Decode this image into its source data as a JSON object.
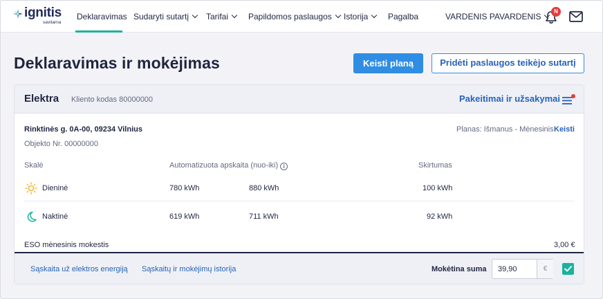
{
  "brand": {
    "name": "ignitis",
    "sub": "savitarna",
    "accent": "#1ab39c",
    "blue": "#2f8de4",
    "link": "#2862b8"
  },
  "nav": {
    "items": [
      {
        "label": "Deklaravimas",
        "has_chevron": false
      },
      {
        "label": "Sudaryti sutartį",
        "has_chevron": true
      },
      {
        "label": "Tarifai",
        "has_chevron": true
      },
      {
        "label": "Papildomos paslaugos",
        "has_chevron": true
      },
      {
        "label": "Istorija",
        "has_chevron": true
      },
      {
        "label": "Pagalba",
        "has_chevron": false
      }
    ],
    "active": "Deklaravimas",
    "user": "VARDENIS PAVARDENIS",
    "notification_badge": "N",
    "icons": [
      "bell-icon",
      "mail-icon",
      "chevron-down-icon"
    ]
  },
  "page": {
    "title": "Deklaravimas ir mokėjimas",
    "primary_button": "Keisti planą",
    "secondary_button": "Pridėti paslaugos teikėjo sutartį"
  },
  "card": {
    "title": "Elektra",
    "client_code": "Kliento kodas 80000000",
    "changes_link": "Pakeitimai ir užsakymai",
    "address": "Rinktinės g. 0A-00, 09234 Vilnius",
    "object_nr": "Objekto Nr. 00000000",
    "plan": "Planas: Išmanus - Mėnesinis",
    "plan_change": "Keisti",
    "headers": {
      "scale": "Skalė",
      "auto": "Automatizuota apskaita (nuo-iki)",
      "diff": "Skirtumas"
    },
    "rows": [
      {
        "name": "Dieninė",
        "icon": "sun-icon",
        "from": "780 kWh",
        "to": "880 kWh",
        "diff": "100 kWh"
      },
      {
        "name": "Naktinė",
        "icon": "moon-icon",
        "from": "619 kWh",
        "to": "711 kWh",
        "diff": "92 kWh"
      }
    ],
    "eso_label": "ESO mėnesinis mokestis",
    "eso_value": "3,00 €",
    "footer": {
      "link1": "Sąskaita už elektros energiją",
      "link2": "Sąskaitų ir mokėjimų istorija",
      "sum_label": "Mokėtina suma",
      "sum_value": "39,90",
      "currency": "€",
      "confirmed": true
    }
  }
}
